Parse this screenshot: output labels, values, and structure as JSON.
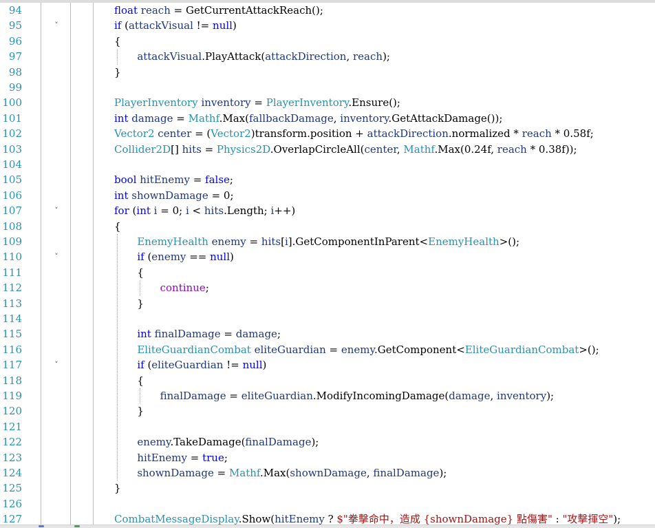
{
  "editor": {
    "lines": [
      {
        "num": "94",
        "code": "float reach = GetCurrentAttackReach();"
      },
      {
        "num": "95",
        "code": "if (attackVisual != null)",
        "fold": true
      },
      {
        "num": "96",
        "code": "{"
      },
      {
        "num": "97",
        "code": "attackVisual.PlayAttack(attackDirection, reach);"
      },
      {
        "num": "98",
        "code": "}"
      },
      {
        "num": "99",
        "code": ""
      },
      {
        "num": "100",
        "code": "PlayerInventory inventory = PlayerInventory.Ensure();"
      },
      {
        "num": "101",
        "code": "int damage = Mathf.Max(fallbackDamage, inventory.GetAttackDamage());"
      },
      {
        "num": "102",
        "code": "Vector2 center = (Vector2)transform.position + attackDirection.normalized * reach * 0.58f;"
      },
      {
        "num": "103",
        "code": "Collider2D[] hits = Physics2D.OverlapCircleAll(center, Mathf.Max(0.24f, reach * 0.38f));"
      },
      {
        "num": "104",
        "code": ""
      },
      {
        "num": "105",
        "code": "bool hitEnemy = false;"
      },
      {
        "num": "106",
        "code": "int shownDamage = 0;"
      },
      {
        "num": "107",
        "code": "for (int i = 0; i < hits.Length; i++)",
        "fold": true
      },
      {
        "num": "108",
        "code": "{"
      },
      {
        "num": "109",
        "code": "EnemyHealth enemy = hits[i].GetComponentInParent<EnemyHealth>();"
      },
      {
        "num": "110",
        "code": "if (enemy == null)",
        "fold": true
      },
      {
        "num": "111",
        "code": "{"
      },
      {
        "num": "112",
        "code": "continue;"
      },
      {
        "num": "113",
        "code": "}"
      },
      {
        "num": "114",
        "code": ""
      },
      {
        "num": "115",
        "code": "int finalDamage = damage;"
      },
      {
        "num": "116",
        "code": "EliteGuardianCombat eliteGuardian = enemy.GetComponent<EliteGuardianCombat>();"
      },
      {
        "num": "117",
        "code": "if (eliteGuardian != null)",
        "fold": true
      },
      {
        "num": "118",
        "code": "{"
      },
      {
        "num": "119",
        "code": "finalDamage = eliteGuardian.ModifyIncomingDamage(damage, inventory);"
      },
      {
        "num": "120",
        "code": "}"
      },
      {
        "num": "121",
        "code": ""
      },
      {
        "num": "122",
        "code": "enemy.TakeDamage(finalDamage);"
      },
      {
        "num": "123",
        "code": "hitEnemy = true;"
      },
      {
        "num": "124",
        "code": "shownDamage = Mathf.Max(shownDamage, finalDamage);"
      },
      {
        "num": "125",
        "code": "}"
      },
      {
        "num": "126",
        "code": ""
      },
      {
        "num": "127",
        "code": "CombatMessageDisplay.Show(hitEnemy ? $\"拳擊命中，造成 {shownDamage} 點傷害\" : \"攻擊揮空\");"
      }
    ]
  },
  "colors": {
    "keyword": "#0000ff",
    "type": "#2b91af",
    "string": "#a31515",
    "variable": "#1f377f",
    "control": "#8f08c4",
    "line_number": "#2b91af"
  }
}
